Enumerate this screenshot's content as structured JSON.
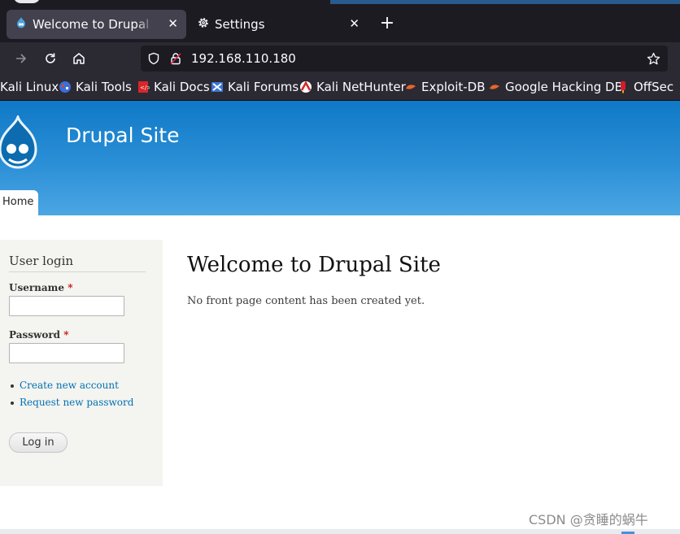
{
  "browser": {
    "tabs": [
      {
        "title": "Welcome to Drupal Site | D",
        "active": true
      },
      {
        "title": "Settings",
        "active": false
      }
    ],
    "url": "192.168.110.180",
    "bookmarks": [
      {
        "label": "Kali Linux",
        "icon": "kali-icon"
      },
      {
        "label": "Kali Tools",
        "icon": "kali-tools-icon"
      },
      {
        "label": "Kali Docs",
        "icon": "kali-docs-icon"
      },
      {
        "label": "Kali Forums",
        "icon": "kali-forums-icon"
      },
      {
        "label": "Kali NetHunter",
        "icon": "nethunter-icon"
      },
      {
        "label": "Exploit-DB",
        "icon": "exploit-db-icon"
      },
      {
        "label": "Google Hacking DB",
        "icon": "ghdb-icon"
      },
      {
        "label": "OffSec",
        "icon": "offsec-icon"
      }
    ]
  },
  "site": {
    "name": "Drupal Site",
    "tabs": [
      {
        "label": "Home",
        "active": true
      }
    ]
  },
  "login": {
    "title": "User login",
    "username_label": "Username",
    "password_label": "Password",
    "required_mark": "*",
    "username_value": "",
    "password_value": "",
    "links": [
      "Create new account",
      "Request new password"
    ],
    "submit_label": "Log in"
  },
  "main": {
    "title": "Welcome to Drupal Site",
    "text": "No front page content has been created yet."
  },
  "watermark": "CSDN @贪睡的蜗牛",
  "colors": {
    "header_top": "#0f79c7",
    "header_bottom": "#4ba6e3",
    "link": "#0071b3",
    "required": "#cc1111",
    "sidebar_bg": "#f4f4f0"
  }
}
